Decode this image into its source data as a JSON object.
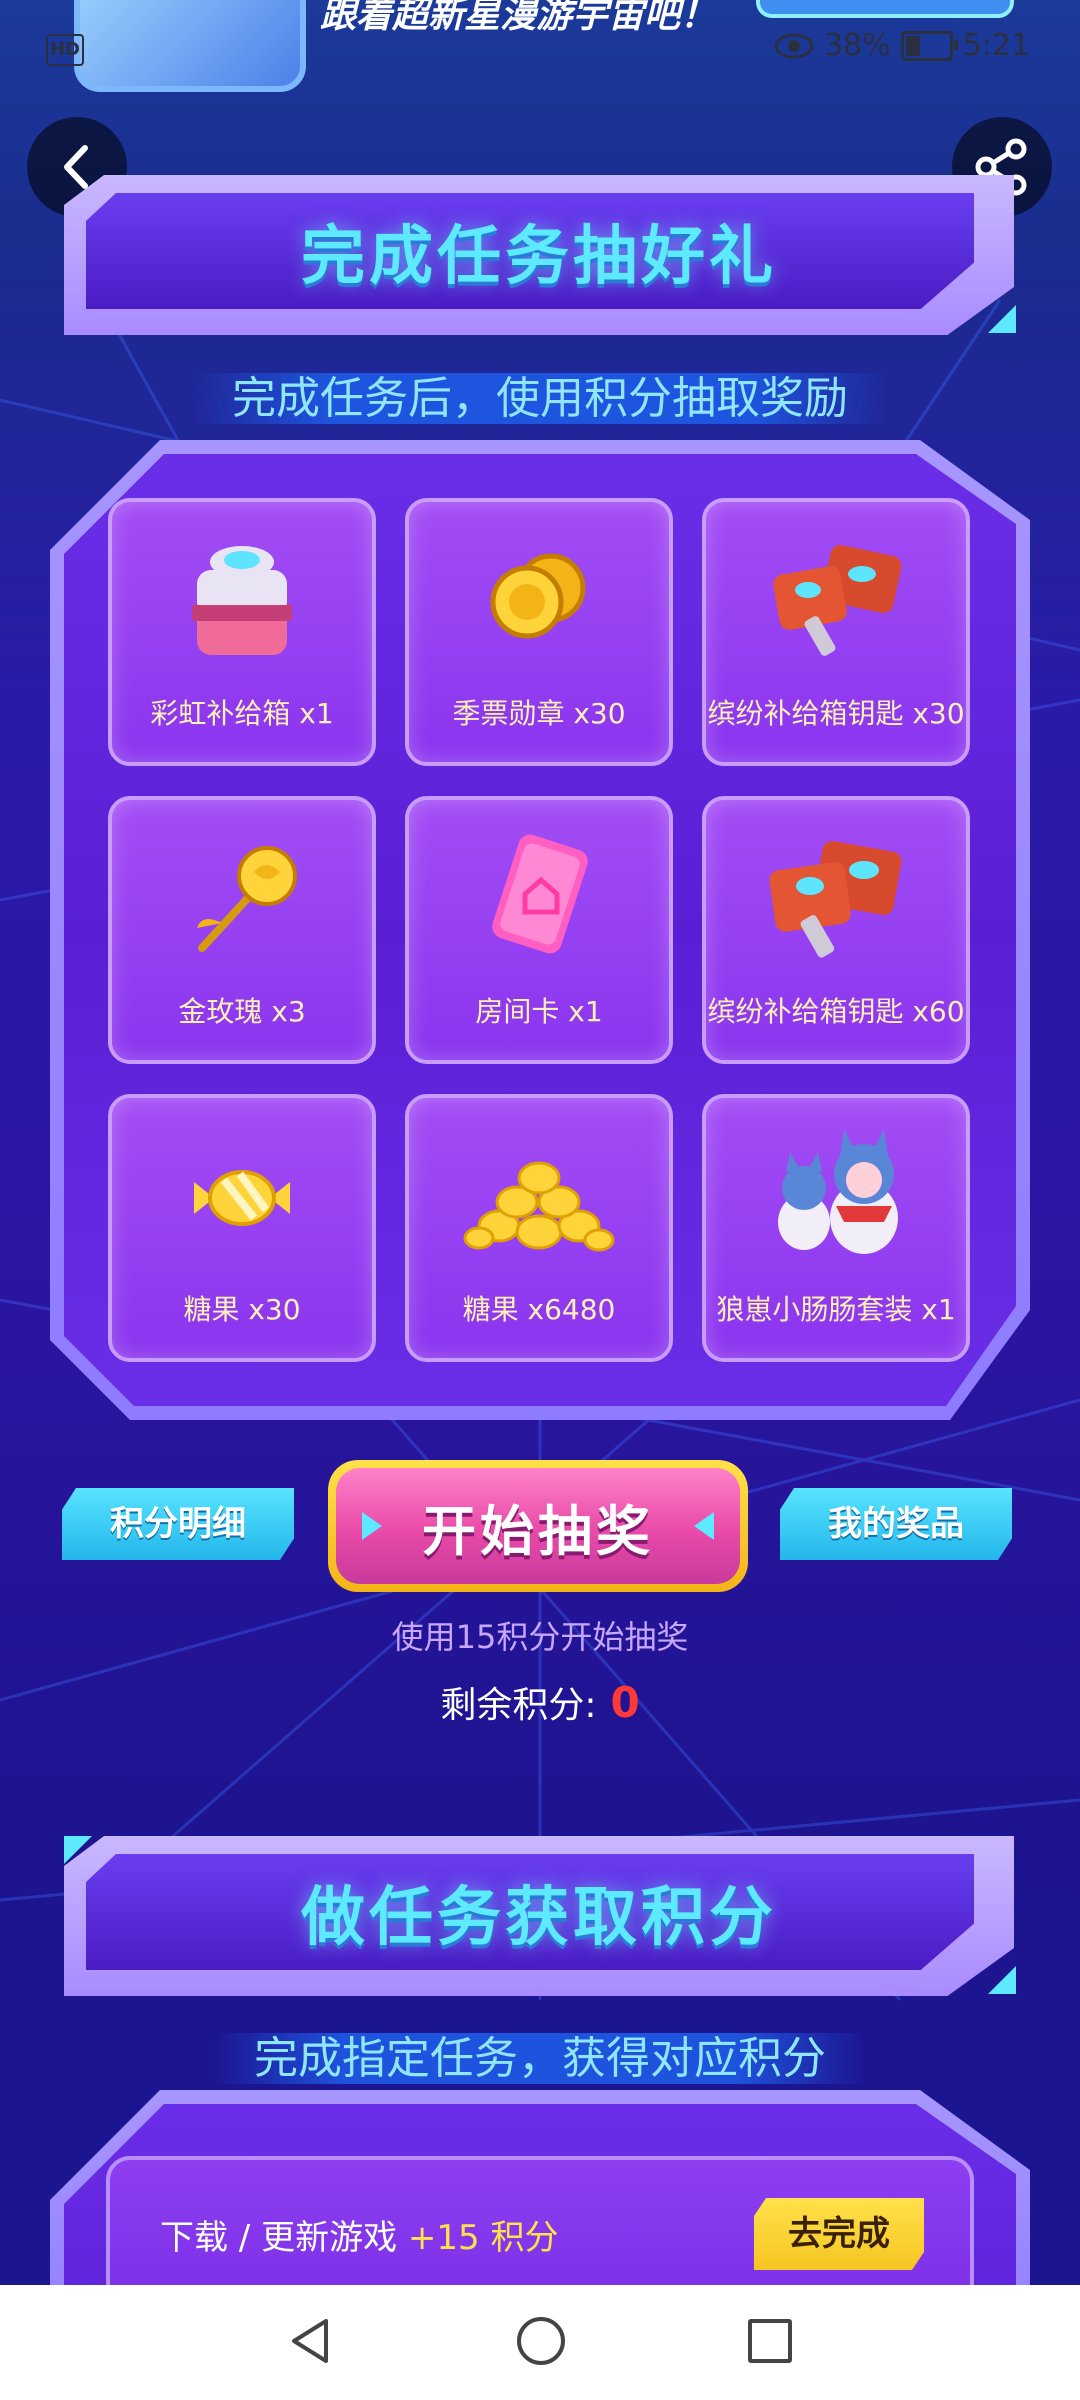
{
  "status_bar": {
    "hd_label": "HD",
    "banner_text": "跟着超新星漫游宇宙吧！",
    "battery_pct": "38%",
    "time": "5:21"
  },
  "section1": {
    "title": "完成任务抽好礼",
    "subtitle": "完成任务后，使用积分抽取奖励"
  },
  "prizes": [
    {
      "icon": "rainbow-supply-box-icon",
      "label": "彩虹补给箱 x1"
    },
    {
      "icon": "season-medal-icon",
      "label": "季票勋章 x30"
    },
    {
      "icon": "supply-key-icon",
      "label": "缤纷补给箱钥匙 x30"
    },
    {
      "icon": "golden-rose-icon",
      "label": "金玫瑰 x3"
    },
    {
      "icon": "room-card-icon",
      "label": "房间卡 x1"
    },
    {
      "icon": "supply-key-icon",
      "label": "缤纷补给箱钥匙 x60"
    },
    {
      "icon": "candy-icon",
      "label": "糖果 x30"
    },
    {
      "icon": "candy-pile-icon",
      "label": "糖果 x6480"
    },
    {
      "icon": "wolf-costume-icon",
      "label": "狼崽小肠肠套装 x1"
    }
  ],
  "actions": {
    "points_detail": "积分明细",
    "start_draw": "开始抽奖",
    "my_prizes": "我的奖品",
    "hint": "使用15积分开始抽奖",
    "remain_label": "剩余积分:",
    "remain_value": "0"
  },
  "section2": {
    "title": "做任务获取积分",
    "subtitle": "完成指定任务，获得对应积分"
  },
  "tasks": [
    {
      "label": "下载 / 更新游戏",
      "points": "+15 积分",
      "button": "去完成"
    }
  ],
  "colors": {
    "accent_cyan": "#5de9ff",
    "accent_gold": "#ffe14a",
    "accent_pink": "#e84aa8",
    "remain_red": "#ff3838"
  }
}
